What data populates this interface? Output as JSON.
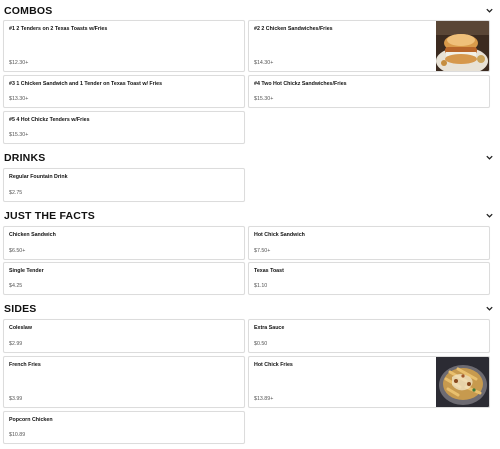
{
  "sections": [
    {
      "title": "COMBOS",
      "items": [
        {
          "name": "#1 2 Tenders on 2 Texas Toasts w/Fries",
          "price": "$12.30+"
        },
        {
          "name": "#2 2 Chicken Sandwiches/Fries",
          "price": "$14.30+",
          "image": "chicken-sandwich-photo"
        },
        {
          "name": "#3 1 Chicken Sandwich and 1 Tender on Texas Toast w/ Fries",
          "price": "$13.30+"
        },
        {
          "name": "#4 Two Hot Chickz Sandwiches/Fries",
          "price": "$15.30+"
        },
        {
          "name": "#5 4 Hot Chickz Tenders w/Fries",
          "price": "$15.30+"
        }
      ]
    },
    {
      "title": "DRINKS",
      "items": [
        {
          "name": "Regular Fountain Drink",
          "price": "$2.75"
        }
      ]
    },
    {
      "title": "JUST THE FACTS",
      "items": [
        {
          "name": "Chicken Sandwich",
          "price": "$6.50+"
        },
        {
          "name": "Hot Chick Sandwich",
          "price": "$7.50+"
        },
        {
          "name": "Single Tender",
          "price": "$4.25"
        },
        {
          "name": "Texas Toast",
          "price": "$1.10"
        }
      ]
    },
    {
      "title": "SIDES",
      "items": [
        {
          "name": "Coleslaw",
          "price": "$2.99"
        },
        {
          "name": "Extra Sauce",
          "price": "$0.50"
        },
        {
          "name": "French Fries",
          "price": "$3.99"
        },
        {
          "name": "Hot Chick Fries",
          "price": "$13.89+",
          "image": "loaded-fries-photo"
        },
        {
          "name": "Popcorn Chicken",
          "price": "$10.89"
        }
      ]
    }
  ],
  "icons": {
    "collapse": "chevron-down-icon"
  },
  "colors": {
    "card_border": "#dcdcdc",
    "text": "#111111",
    "price": "#555555"
  }
}
